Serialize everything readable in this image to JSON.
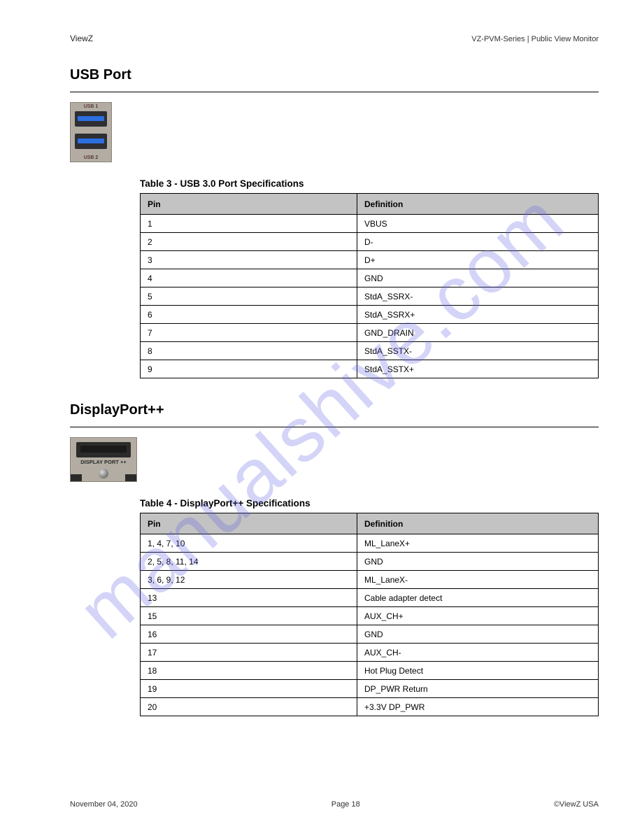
{
  "header": {
    "brand": "ViewZ",
    "docref": "VZ-PVM-Series | Public View Monitor"
  },
  "watermark": "manualshive.com",
  "section1": {
    "title": "USB Port",
    "photo_labels": {
      "top": "USB 1",
      "bottom": "USB 2"
    },
    "table_caption": "Table 3 - USB 3.0 Port Specifications",
    "headers": [
      "Pin",
      "Definition"
    ],
    "rows": [
      [
        "1",
        "VBUS"
      ],
      [
        "2",
        "D-"
      ],
      [
        "3",
        "D+"
      ],
      [
        "4",
        "GND"
      ],
      [
        "5",
        "StdA_SSRX-"
      ],
      [
        "6",
        "StdA_SSRX+"
      ],
      [
        "7",
        "GND_DRAIN"
      ],
      [
        "8",
        "StdA_SSTX-"
      ],
      [
        "9",
        "StdA_SSTX+"
      ]
    ]
  },
  "section2": {
    "title": "DisplayPort++",
    "photo_label": "DISPLAY PORT ++",
    "table_caption": "Table 4 - DisplayPort++ Specifications",
    "headers": [
      "Pin",
      "Definition"
    ],
    "rows": [
      [
        "1, 4, 7, 10",
        "ML_LaneX+"
      ],
      [
        "2, 5, 8, 11, 14",
        "GND"
      ],
      [
        "3, 6, 9, 12",
        "ML_LaneX-"
      ],
      [
        "13",
        "Cable adapter detect"
      ],
      [
        "15",
        "AUX_CH+"
      ],
      [
        "16",
        "GND"
      ],
      [
        "17",
        "AUX_CH-"
      ],
      [
        "18",
        "Hot Plug Detect"
      ],
      [
        "19",
        "DP_PWR Return"
      ],
      [
        "20",
        "+3.3V DP_PWR"
      ]
    ]
  },
  "footer": {
    "pub": "November 04, 2020",
    "page": "Page 18",
    "copyright": "©ViewZ USA"
  }
}
